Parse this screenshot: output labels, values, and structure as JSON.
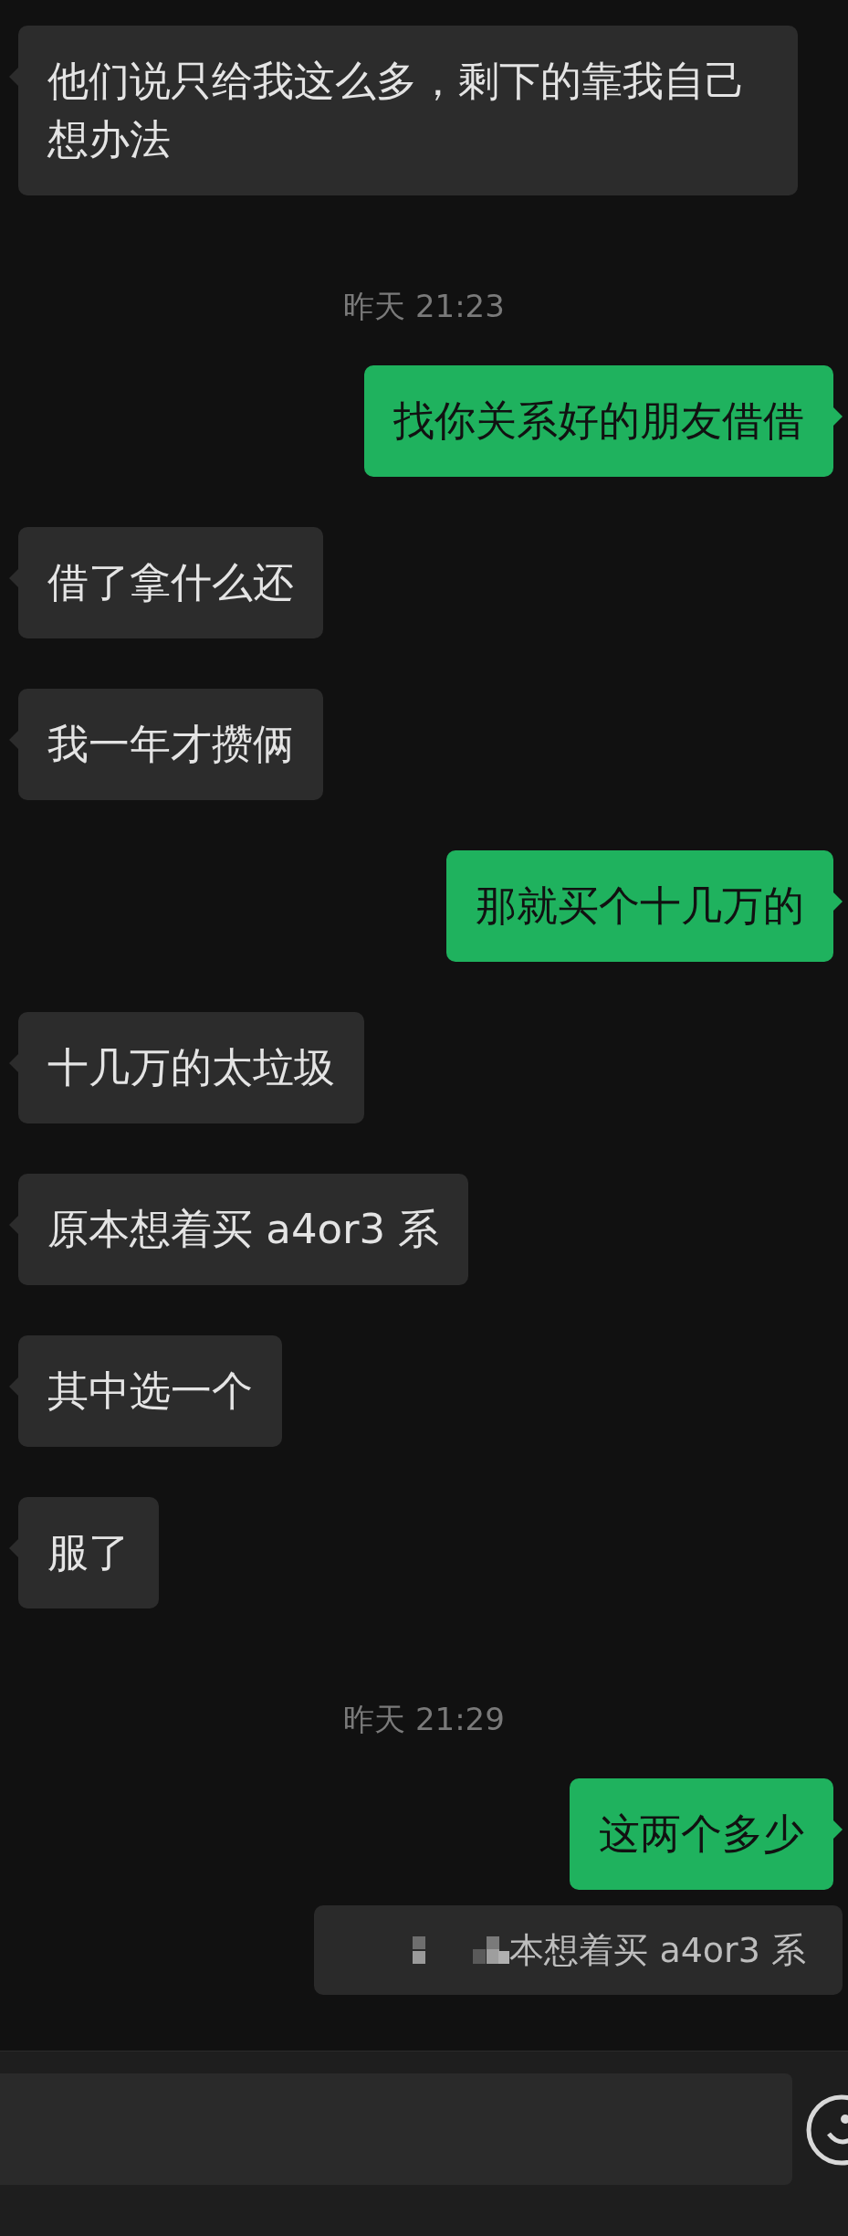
{
  "messages": [
    {
      "kind": "received",
      "text": "他们说只给我这么多，剩下的靠我自己想办法"
    },
    {
      "kind": "timestamp",
      "text": "昨天 21:23"
    },
    {
      "kind": "sent",
      "text": "找你关系好的朋友借借"
    },
    {
      "kind": "received",
      "text": "借了拿什么还"
    },
    {
      "kind": "received",
      "text": "我一年才攒俩"
    },
    {
      "kind": "sent",
      "text": "那就买个十几万的"
    },
    {
      "kind": "received",
      "text": "十几万的太垃圾"
    },
    {
      "kind": "received",
      "text": "原本想着买 a4or3 系"
    },
    {
      "kind": "received",
      "text": "其中选一个"
    },
    {
      "kind": "received",
      "text": "服了"
    },
    {
      "kind": "timestamp",
      "text": "昨天 21:29"
    },
    {
      "kind": "sent",
      "text": "这两个多少"
    },
    {
      "kind": "quote",
      "text": "本想着买 a4or3 系"
    }
  ]
}
